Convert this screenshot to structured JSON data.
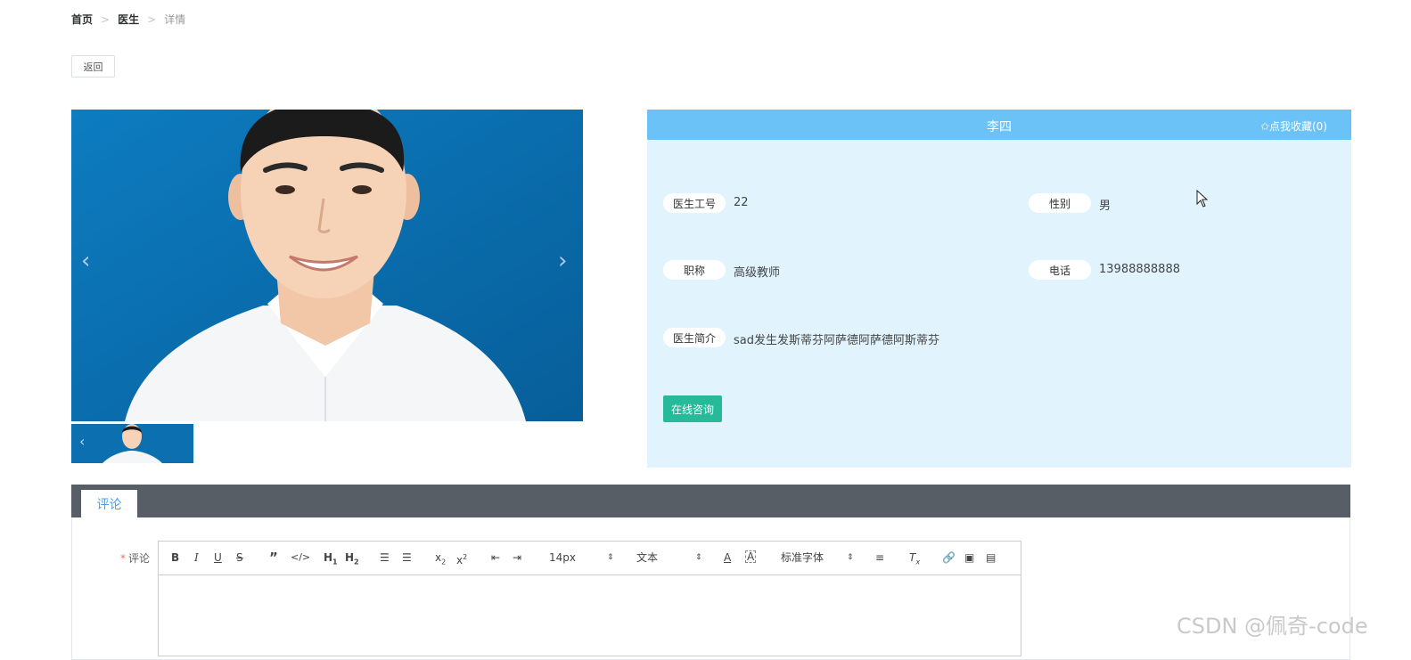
{
  "breadcrumb": {
    "items": [
      "首页",
      "医生",
      "详情"
    ],
    "separator": ">"
  },
  "back_label": "返回",
  "doctor": {
    "name": "李四",
    "favorite_label": "✩点我收藏(0)",
    "fields": [
      {
        "label": "医生工号",
        "value": "22"
      },
      {
        "label": "性别",
        "value": "男"
      },
      {
        "label": "职称",
        "value": "高级教师"
      },
      {
        "label": "电话",
        "value": "13988888888"
      },
      {
        "label": "医生简介",
        "value": "sad发生发斯蒂芬阿萨德阿萨德阿斯蒂芬"
      }
    ],
    "consult_label": "在线咨询"
  },
  "tabs": [
    "评论"
  ],
  "comment": {
    "required_mark": "*",
    "label": "评论"
  },
  "editor": {
    "font_size": "14px",
    "block_type": "文本",
    "font_family": "标准字体"
  },
  "watermark": "CSDN @佩奇-code",
  "colors": {
    "header_blue": "#6bc2f7",
    "panel_bg": "#e1f3fd",
    "consult_green": "#26b99a",
    "tab_bar": "#575e66"
  }
}
